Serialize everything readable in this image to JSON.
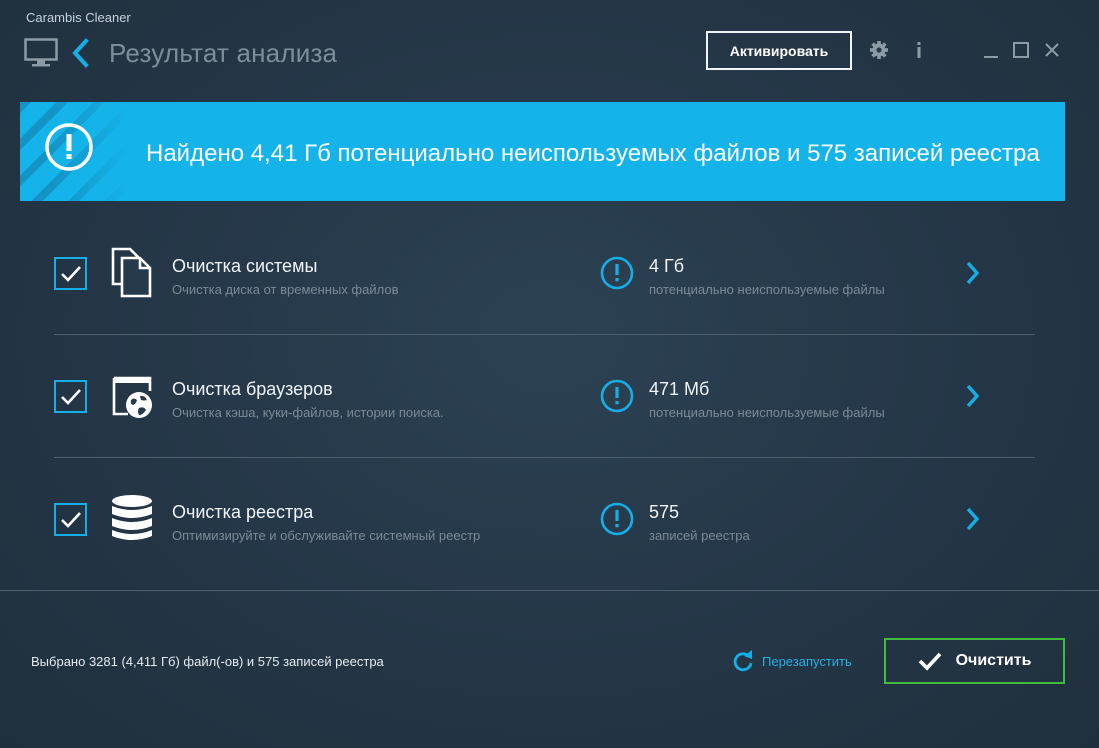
{
  "app": {
    "name": "Carambis Cleaner"
  },
  "header": {
    "title": "Результат анализа",
    "activate_label": "Активировать",
    "icons": [
      "monitor-icon",
      "back-chevron-icon",
      "gear-icon",
      "info-icon",
      "minimize-icon",
      "maximize-icon",
      "close-icon"
    ]
  },
  "banner": {
    "text": "Найдено 4,41 Гб потенциально неиспользуемых файлов и 575 записей реестра",
    "icon": "exclamation-circle-icon",
    "color": "#14b4ea"
  },
  "items": [
    {
      "checked": true,
      "icon": "files-icon",
      "title": "Очистка системы",
      "subtitle": "Очистка диска от временных файлов",
      "stat_value": "4 Гб",
      "stat_label": "потенциально неиспользуемые файлы"
    },
    {
      "checked": true,
      "icon": "browser-globe-icon",
      "title": "Очистка браузеров",
      "subtitle": "Очистка кэша, куки-файлов, истории поиска.",
      "stat_value": "471 Мб",
      "stat_label": "потенциально неиспользуемые файлы"
    },
    {
      "checked": true,
      "icon": "database-icon",
      "title": "Очистка реестра",
      "subtitle": "Оптимизируйте и обслуживайте системный реестр",
      "stat_value": "575",
      "stat_label": "записей реестра"
    }
  ],
  "footer": {
    "status": "Выбрано 3281 (4,411 Гб) файл(-ов) и 575 записей реестра",
    "restart_label": "Перезапустить",
    "clean_label": "Очистить"
  },
  "colors": {
    "accent": "#16aee6",
    "success": "#41bb3c",
    "background": "#26394a"
  }
}
